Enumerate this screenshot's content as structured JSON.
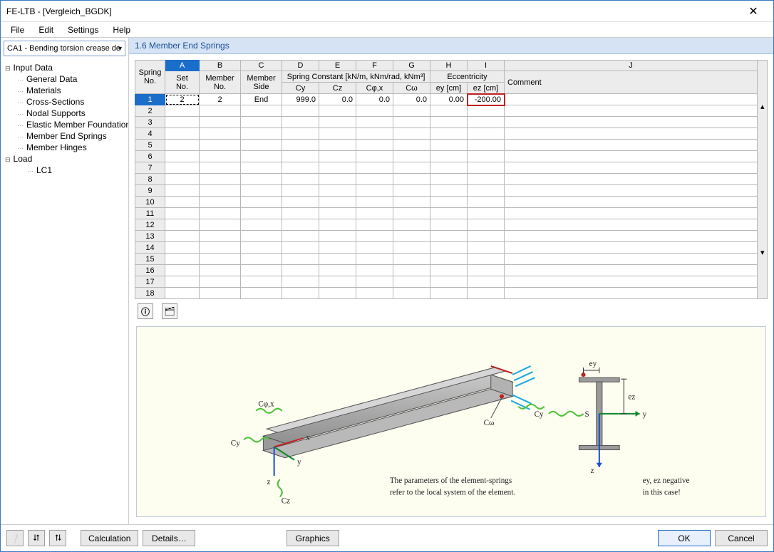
{
  "window": {
    "title": "FE-LTB - [Vergleich_BGDK]"
  },
  "menu": {
    "file": "File",
    "edit": "Edit",
    "settings": "Settings",
    "help": "Help"
  },
  "combo": {
    "value": "CA1 - Bending torsion crease de"
  },
  "tree": {
    "root1": "Input Data",
    "items": [
      "General Data",
      "Materials",
      "Cross-Sections",
      "Nodal Supports",
      "Elastic Member Foundations",
      "Member End Springs",
      "Member Hinges"
    ],
    "root2": "Load",
    "items2": [
      "LC1"
    ]
  },
  "panel": {
    "title": "1.6 Member End Springs"
  },
  "grid": {
    "letters": [
      "A",
      "B",
      "C",
      "D",
      "E",
      "F",
      "G",
      "H",
      "I",
      "J"
    ],
    "head_group": {
      "spring_no": "Spring\nNo.",
      "set_no": "Set\nNo.",
      "member_no": "Member\nNo.",
      "member_side": "Member\nSide",
      "spring_const": "Spring Constant [kN/m, kNm/rad, kNm³]",
      "cy": "Cy",
      "cz": "Cz",
      "cphix": "Cφ,x",
      "cw": "Cω",
      "ecc": "Eccentricity",
      "ey": "ey [cm]",
      "ez": "ez [cm]",
      "comment": "Comment"
    },
    "rows": 18,
    "data_row1": {
      "set_no": "2",
      "member_no": "2",
      "member_side": "End",
      "cy": "999.0",
      "cz": "0.0",
      "cphix": "0.0",
      "cw": "0.0",
      "ey": "0.00",
      "ez": "-200.00",
      "comment": ""
    }
  },
  "diagram": {
    "text1": "The parameters of the element-springs",
    "text2": "refer to the local system of the element.",
    "note1": "ey, ez negative",
    "note2": "in this case!",
    "lbl_cphix": "Cφ,x",
    "lbl_cy": "Cy",
    "lbl_cz": "Cz",
    "lbl_cw": "Cω",
    "lbl_x": "x",
    "lbl_y": "y",
    "lbl_z": "z",
    "lbl_s": "S",
    "lbl_ey": "ey",
    "lbl_ez": "ez"
  },
  "footer": {
    "calculation": "Calculation",
    "details": "Details…",
    "graphics": "Graphics",
    "ok": "OK",
    "cancel": "Cancel"
  }
}
